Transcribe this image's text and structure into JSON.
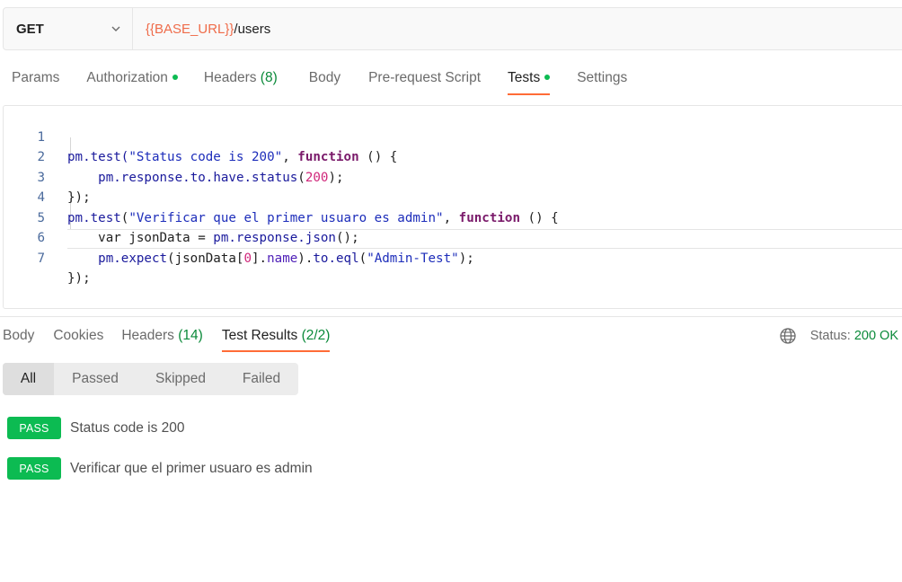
{
  "request": {
    "method": "GET",
    "url_variable": "{{BASE_URL}}",
    "url_path": "/users"
  },
  "request_tabs": [
    {
      "label": "Params",
      "count": "",
      "dot": false,
      "active": false
    },
    {
      "label": "Authorization",
      "count": "",
      "dot": true,
      "active": false
    },
    {
      "label": "Headers",
      "count": "(8)",
      "dot": false,
      "active": false
    },
    {
      "label": "Body",
      "count": "",
      "dot": false,
      "active": false
    },
    {
      "label": "Pre-request Script",
      "count": "",
      "dot": false,
      "active": false
    },
    {
      "label": "Tests",
      "count": "",
      "dot": true,
      "active": true
    },
    {
      "label": "Settings",
      "count": "",
      "dot": false,
      "active": false
    }
  ],
  "editor": {
    "line_numbers": [
      "1",
      "2",
      "3",
      "4",
      "5",
      "6",
      "7"
    ]
  },
  "response_tabs": [
    {
      "label": "Body",
      "count": "",
      "active": false
    },
    {
      "label": "Cookies",
      "count": "",
      "active": false
    },
    {
      "label": "Headers",
      "count": "(14)",
      "active": false
    },
    {
      "label": "Test Results",
      "count": "(2/2)",
      "active": true
    }
  ],
  "status": {
    "label": "Status:",
    "value": "200 OK"
  },
  "filters": [
    "All",
    "Passed",
    "Skipped",
    "Failed"
  ],
  "selected_filter": "All",
  "results": [
    {
      "badge": "PASS",
      "name": "Status code is 200"
    },
    {
      "badge": "PASS",
      "name": "Verificar que el primer usuaro es admin"
    }
  ],
  "colors": {
    "accent": "#ff6c37",
    "pass": "#0cbb52",
    "count": "#0b8a3a",
    "url_variable": "#ef6c4a"
  }
}
